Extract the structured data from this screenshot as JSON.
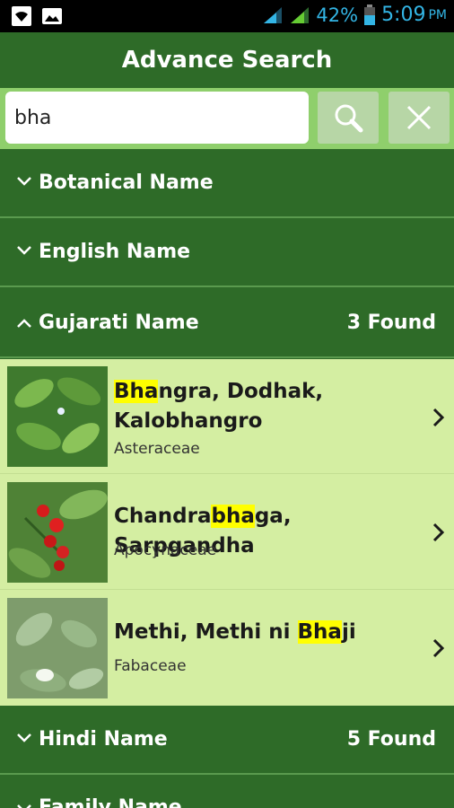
{
  "status_bar": {
    "battery_percent": "42%",
    "time": "5:09",
    "ampm": "PM"
  },
  "header": {
    "title": "Advance Search"
  },
  "search": {
    "value": "bha"
  },
  "sections": [
    {
      "label": "Botanical Name",
      "expanded": false,
      "count": ""
    },
    {
      "label": "English Name",
      "expanded": false,
      "count": ""
    },
    {
      "label": "Gujarati Name",
      "expanded": true,
      "count": "3 Found"
    },
    {
      "label": "Hindi Name",
      "expanded": false,
      "count": "5 Found"
    },
    {
      "label": "Family Name",
      "expanded": false,
      "count": ""
    }
  ],
  "results": [
    {
      "title_before": "",
      "title_match": "Bha",
      "title_after": "ngra, Dodhak, Kalobhangro",
      "family": "Asteraceae"
    },
    {
      "title_before": "Chandra",
      "title_match": "bha",
      "title_after": "ga, Sarpgandha",
      "family": "Apocynaceae"
    },
    {
      "title_before": "Methi, Methi ni ",
      "title_match": "Bha",
      "title_after": "ji",
      "family": "Fabaceae"
    }
  ],
  "colors": {
    "header_green": "#2e6b28",
    "list_background": "#d4eea2",
    "highlight": "#ffff00",
    "status_accent": "#33b5e5"
  }
}
